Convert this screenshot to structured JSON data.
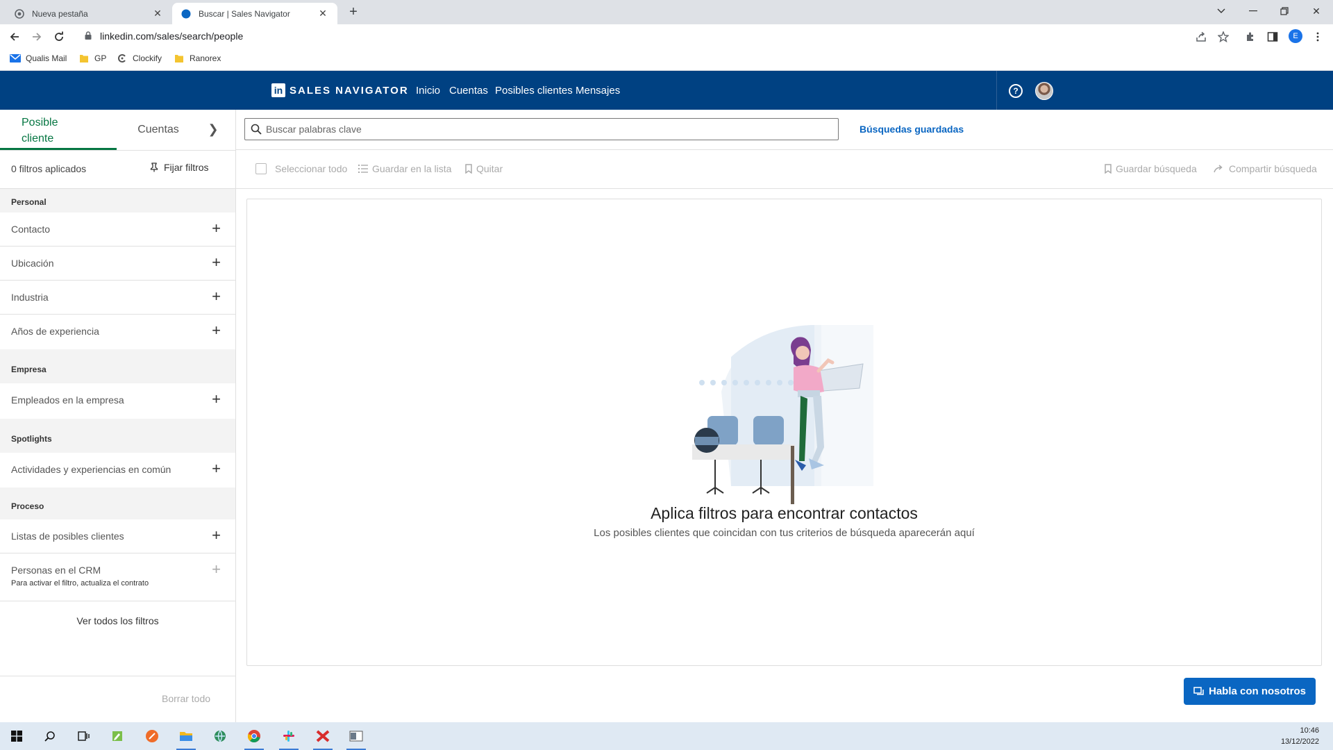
{
  "browser": {
    "tabs": [
      {
        "title": "Nueva pestaña",
        "active": false,
        "icon": "chrome-newtab-icon"
      },
      {
        "title": "Buscar | Sales Navigator",
        "active": true,
        "icon": "sales-navigator-compass-icon"
      }
    ],
    "url": "linkedin.com/sales/search/people",
    "bookmarks": [
      {
        "label": "Qualis Mail",
        "icon": "mail-icon"
      },
      {
        "label": "GP",
        "icon": "folder-icon"
      },
      {
        "label": "Clockify",
        "icon": "clockify-icon"
      },
      {
        "label": "Ranorex",
        "icon": "folder-icon"
      }
    ],
    "profile_initial": "E"
  },
  "header": {
    "logo_text": "SALES NAVIGATOR",
    "nav": [
      "Inicio",
      "Cuentas",
      "Posibles clientes",
      "Mensajes"
    ]
  },
  "left_panel": {
    "tabs": {
      "active_line1": "Posible",
      "active_line2": "cliente",
      "other": "Cuentas",
      "chevron": "❯"
    },
    "filters_applied": "0 filtros aplicados",
    "pin_filters": "Fijar filtros",
    "sections": {
      "personal": "Personal",
      "empresa": "Empresa",
      "spotlights": "Spotlights",
      "proceso": "Proceso"
    },
    "filters": {
      "contacto": "Contacto",
      "ubicacion": "Ubicación",
      "industria": "Industria",
      "anos": "Años de experiencia",
      "empleados": "Empleados en la empresa",
      "actividades": "Actividades y experiencias en común",
      "listas": "Listas de posibles clientes",
      "crm": "Personas en el CRM"
    },
    "crm_note": "Para activar el filtro, actualiza el contrato",
    "see_all": "Ver todos los filtros",
    "clear_all": "Borrar todo"
  },
  "main": {
    "search_placeholder": "Buscar palabras clave",
    "saved_searches": "Búsquedas guardadas",
    "actions": {
      "select_all": "Seleccionar todo",
      "save_to_list": "Guardar en la lista",
      "remove": "Quitar",
      "save_search": "Guardar búsqueda",
      "share_search": "Compartir búsqueda"
    },
    "empty_title": "Aplica filtros para encontrar contactos",
    "empty_subtitle": "Los posibles clientes que coincidan con tus criterios de búsqueda aparecerán aquí",
    "chat_button": "Habla con nosotros"
  },
  "taskbar": {
    "time": "10:46",
    "date": "13/12/2022",
    "apps": [
      "windows-start-icon",
      "search-icon",
      "task-view-icon",
      "notepad-icon",
      "postman-icon",
      "file-explorer-icon",
      "network-icon",
      "chrome-icon",
      "slack-icon",
      "xmind-icon",
      "terminal-icon"
    ]
  },
  "colors": {
    "header_bg": "#004182",
    "accent_green": "#057642",
    "link_blue": "#0a66c2"
  }
}
